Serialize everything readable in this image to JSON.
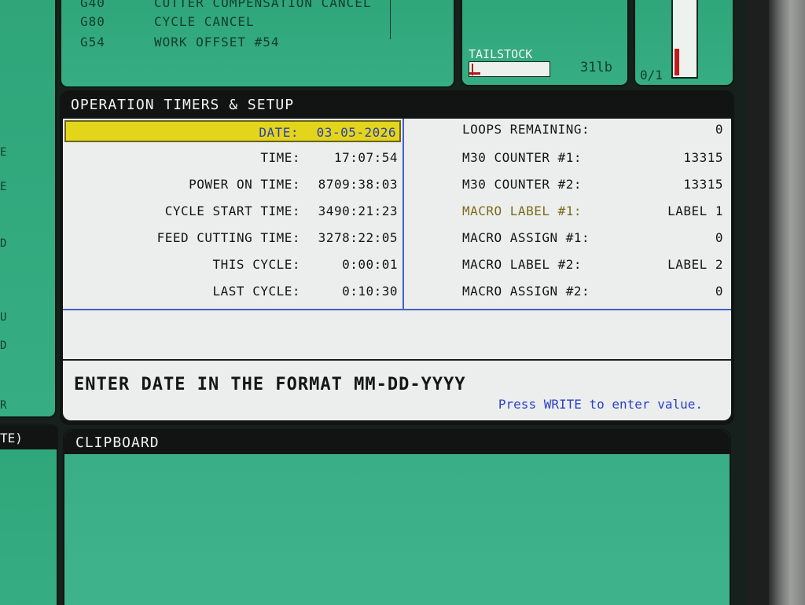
{
  "codes": [
    {
      "code": "G40",
      "desc": "CUTTER COMPENSATION CANCEL"
    },
    {
      "code": "G80",
      "desc": "CYCLE CANCEL"
    },
    {
      "code": "G54",
      "desc": "WORK OFFSET  #54"
    }
  ],
  "tailstock": {
    "label": "TAILSTOCK",
    "value": "31lb"
  },
  "gauge": {
    "label": "0/1",
    "level": 0.35
  },
  "left_strip": {
    "letters": [
      "E",
      "E",
      "D",
      "U",
      "D",
      "R"
    ],
    "bottom_label": "TE)"
  },
  "timers": {
    "title": "OPERATION TIMERS & SETUP",
    "left_rows": [
      {
        "label": "DATE:",
        "value": "03-05-2026"
      },
      {
        "label": "TIME:",
        "value": "17:07:54"
      },
      {
        "label": "POWER ON TIME:",
        "value": "8709:38:03"
      },
      {
        "label": "CYCLE START TIME:",
        "value": "3490:21:23"
      },
      {
        "label": "FEED CUTTING TIME:",
        "value": "3278:22:05"
      },
      {
        "label": "THIS CYCLE:",
        "value": "0:00:01"
      },
      {
        "label": "LAST CYCLE:",
        "value": "0:10:30"
      }
    ],
    "right_rows": [
      {
        "label": "LOOPS REMAINING:",
        "value": "0"
      },
      {
        "label": "M30 COUNTER #1:",
        "value": "13315"
      },
      {
        "label": "M30 COUNTER #2:",
        "value": "13315"
      },
      {
        "label": "MACRO LABEL #1:",
        "value": "LABEL 1"
      },
      {
        "label": "MACRO ASSIGN #1:",
        "value": "0"
      },
      {
        "label": "MACRO LABEL #2:",
        "value": "LABEL 2"
      },
      {
        "label": "MACRO ASSIGN #2:",
        "value": "0"
      }
    ],
    "prompt": "ENTER DATE IN THE FORMAT MM-DD-YYYY",
    "hint": "Press WRITE to enter value."
  },
  "clipboard": {
    "title": "CLIPBOARD"
  },
  "colors": {
    "panel_green": "#36ad82",
    "highlight_yellow": "#e3d41c",
    "accent_blue": "#2a3fc8",
    "alarm_red": "#c21c1c"
  }
}
